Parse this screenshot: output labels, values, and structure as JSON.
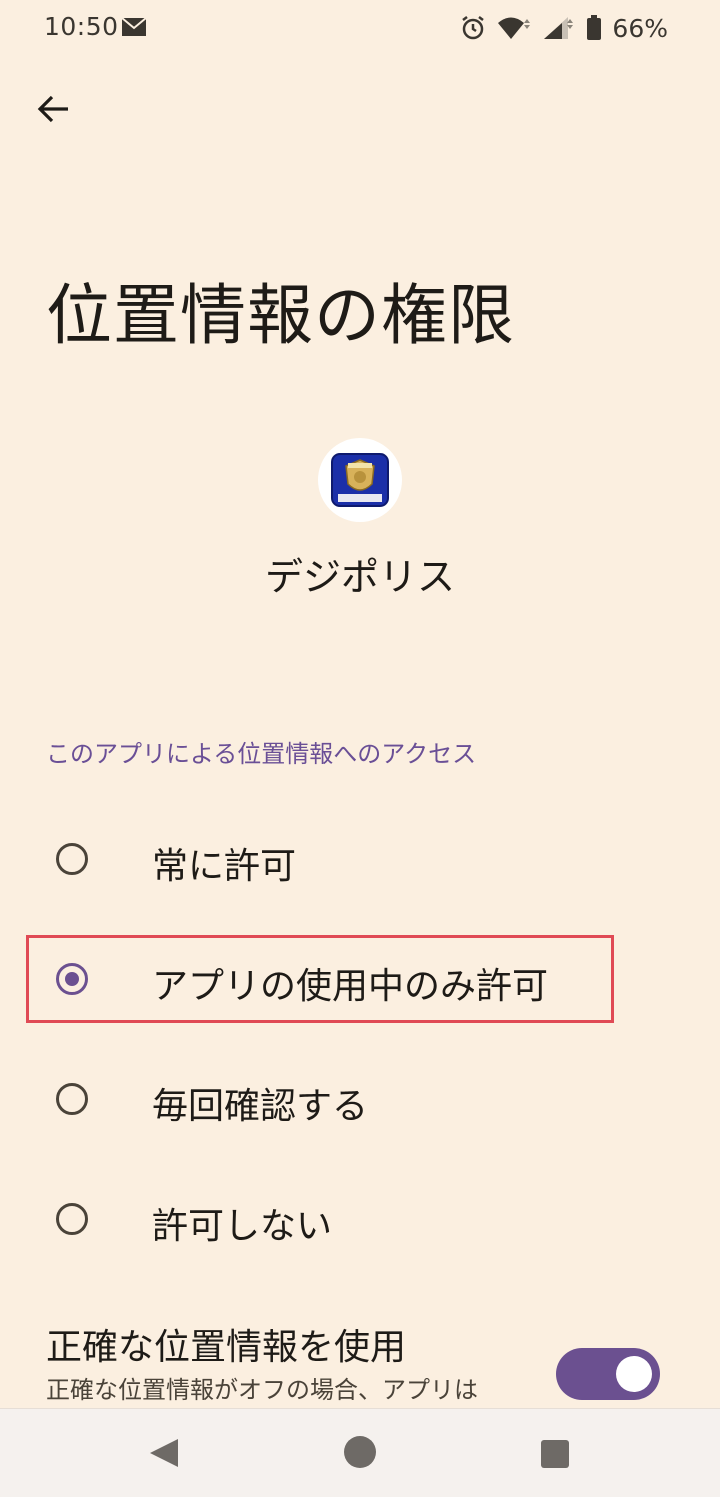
{
  "status_bar": {
    "time": "10:50",
    "battery": "66%",
    "icons": [
      "mail-icon",
      "alarm-icon",
      "wifi-icon",
      "signal-icon",
      "battery-icon"
    ]
  },
  "page": {
    "title": "位置情報の権限"
  },
  "app": {
    "name": "デジポリス",
    "icon": "digi-police-badge-icon"
  },
  "location_access": {
    "header": "このアプリによる位置情報へのアクセス",
    "options": [
      {
        "label": "常に許可",
        "selected": false
      },
      {
        "label": "アプリの使用中のみ許可",
        "selected": true
      },
      {
        "label": "毎回確認する",
        "selected": false
      },
      {
        "label": "許可しない",
        "selected": false
      }
    ]
  },
  "precise_location": {
    "title": "正確な位置情報を使用",
    "description": "正確な位置情報がオフの場合、アプリは",
    "enabled": true
  },
  "colors": {
    "background": "#FBEFE0",
    "accent": "#6B5090",
    "highlight": "#E04A55"
  }
}
